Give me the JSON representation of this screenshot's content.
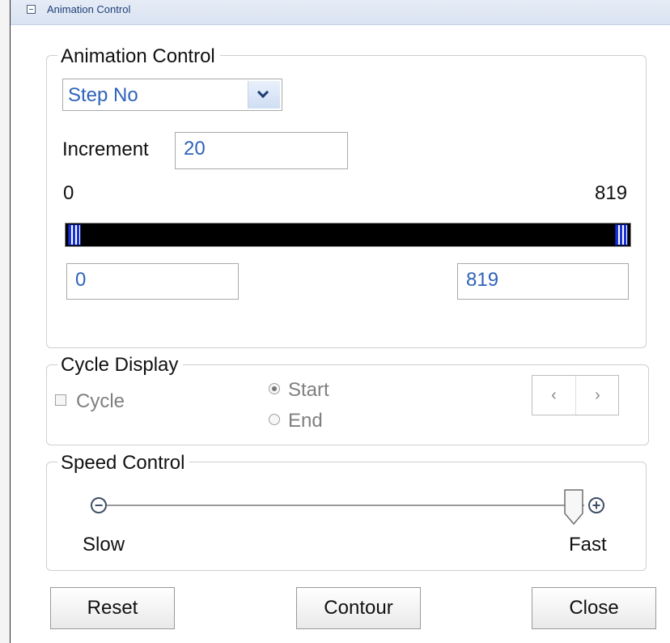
{
  "window": {
    "title": "Animation Control"
  },
  "animation_control": {
    "legend": "Animation Control",
    "mode_select": {
      "value": "Step No"
    },
    "increment": {
      "label": "Increment",
      "value": "20"
    },
    "range": {
      "min_label": "0",
      "max_label": "819",
      "start_value": "0",
      "end_value": "819"
    }
  },
  "cycle_display": {
    "legend": "Cycle Display",
    "cycle_label": "Cycle",
    "start_label": "Start",
    "end_label": "End",
    "prev_symbol": "‹",
    "next_symbol": "›"
  },
  "speed_control": {
    "legend": "Speed Control",
    "slow_label": "Slow",
    "fast_label": "Fast",
    "minus_symbol": "−",
    "plus_symbol": "+",
    "value_fraction": 1.0
  },
  "buttons": {
    "reset": "Reset",
    "contour": "Contour",
    "close": "Close"
  },
  "colors": {
    "value_text": "#2f63b8",
    "range_handle": "#1932d6"
  }
}
